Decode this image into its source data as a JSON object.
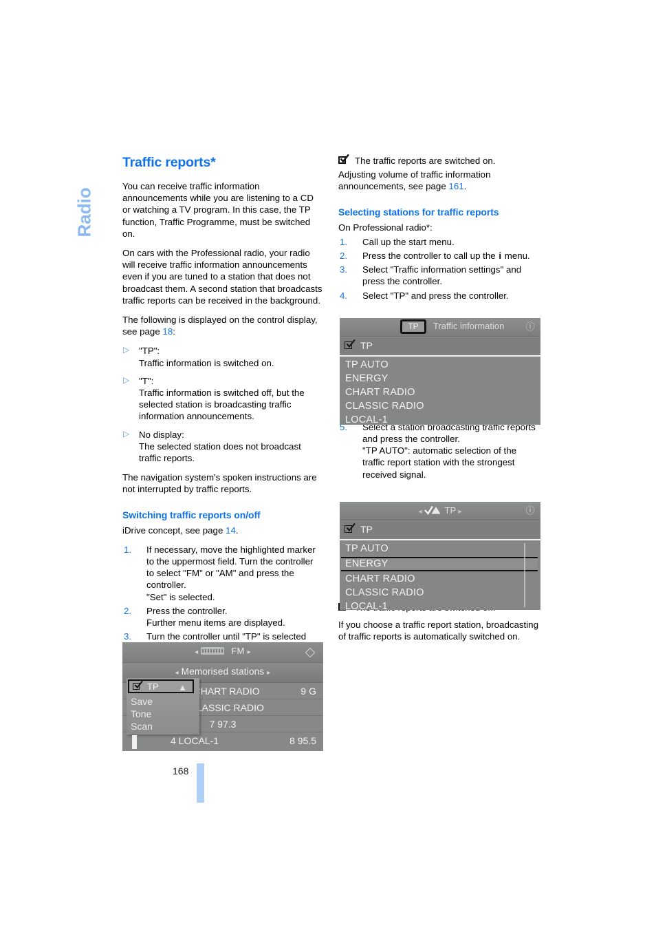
{
  "chapter": {
    "label": "Radio"
  },
  "page": {
    "number": "168"
  },
  "left": {
    "title": "Traffic reports*",
    "intro_1": "You can receive traffic information announcements while you are listening to a CD or watching a TV program. In this case, the TP function, Traffic Programme, must be switched on.",
    "intro_2": "On cars with the Professional radio, your radio will receive traffic information announcements even if you are tuned to a station that does not broadcast them. A second station that broadcasts traffic reports can be received in the background.",
    "display_lead": "The following is displayed on the control display, see page ",
    "display_lead_page": "18",
    "display_lead_end": ":",
    "bullets": [
      {
        "term": "\"TP\":",
        "desc": "Traffic information is switched on."
      },
      {
        "term": "\"T\":",
        "desc": "Traffic information is switched off, but the selected station is broadcasting traffic information announcements."
      },
      {
        "term": "No display:",
        "desc": "The selected station does not broadcast traffic reports."
      }
    ],
    "nav_note": "The navigation system's spoken instructions are not interrupted by traffic reports.",
    "subtitle": "Switching traffic reports on/off",
    "idrive_lead": "iDrive concept, see page ",
    "idrive_page": "14",
    "idrive_end": ".",
    "steps": [
      {
        "num": "1.",
        "text": "If necessary, move the highlighted marker to the uppermost field. Turn the controller to select \"FM\" or \"AM\" and press the controller.\n\"Set\" is selected."
      },
      {
        "num": "2.",
        "text": "Press the controller.\nFurther menu items are displayed."
      },
      {
        "num": "3.",
        "text": "Turn the controller until \"TP\" is selected and press the controller."
      }
    ]
  },
  "right": {
    "note_top": "The traffic reports are switched on.",
    "volume_lead": "Adjusting volume of traffic information announcements, see page ",
    "volume_page": "161",
    "volume_end": ".",
    "subtitle": "Selecting stations for traffic reports",
    "radio_lead": "On Professional radio*:",
    "steps": [
      {
        "num": "1.",
        "text": "Call up the start menu."
      },
      {
        "num": "2.",
        "text_before": "Press the controller to call up the ",
        "icon": "i",
        "text_after": " menu."
      },
      {
        "num": "3.",
        "text": "Select \"Traffic information settings\" and press the controller."
      },
      {
        "num": "4.",
        "text": "Select \"TP\" and press the controller."
      },
      {
        "num": "5.",
        "text": "Select a station broadcasting traffic reports and press the controller.\n\"TP AUTO\": automatic selection of the traffic report station with the strongest received signal."
      }
    ],
    "note_bottom": "The traffic reports are switched on.",
    "closing": "If you choose a traffic report station, broadcasting of traffic reports is automatically switched on."
  },
  "screenshots": {
    "shot1": {
      "name": "radio-fm-memorised-stations-display",
      "top_band": "FM",
      "sub_band": "Memorised stations",
      "popup_highlight": "TP",
      "popup_items": [
        "Save",
        "Tone",
        "Scan"
      ],
      "rows": [
        {
          "left": "5 CHART RADIO",
          "right": "9 G"
        },
        {
          "center": "6 CLASSIC RADIO"
        },
        {
          "center": "7 97.3"
        },
        {
          "left": "4 LOCAL-1",
          "right": "8 95.5"
        }
      ]
    },
    "shot2": {
      "name": "traffic-information-settings-display",
      "button": "TP",
      "header_title": "Traffic information",
      "checkbox_label": "TP",
      "items": [
        "TP AUTO",
        "ENERGY",
        "CHART RADIO",
        "CLASSIC RADIO",
        "LOCAL-1"
      ],
      "selected": null
    },
    "shot3": {
      "name": "traffic-information-station-selected-display",
      "header_title": "TP",
      "checkbox_label": "TP",
      "items": [
        "TP AUTO",
        "ENERGY",
        "CHART RADIO",
        "CLASSIC RADIO",
        "LOCAL-1"
      ],
      "selected": "ENERGY"
    }
  }
}
